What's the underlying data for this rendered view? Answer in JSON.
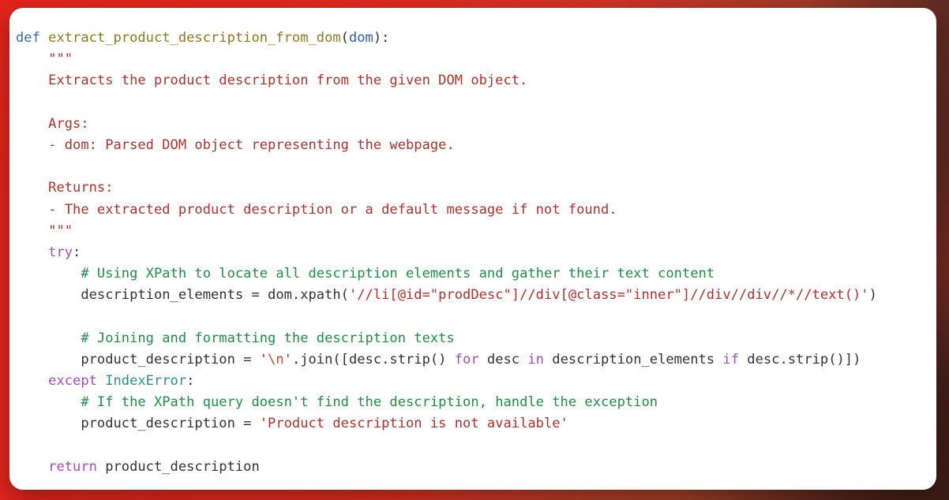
{
  "window": {
    "title": "Python code snippet",
    "background_colors": {
      "primary_red": "#e0241c",
      "dark_brown": "#3b211c",
      "card_background": "#ffffff"
    }
  },
  "editor": {
    "language": "python",
    "font": "monospace",
    "theme_colors": {
      "keyword": "#3a6ea5",
      "function_name": "#8f7a1e",
      "parameter": "#2b62bd",
      "string": "#b5312c",
      "escape": "#e8452d",
      "comment": "#1f9145",
      "control_keyword": "#a34cc4",
      "exception": "#2f8f8f",
      "plain_text": "#333333"
    },
    "lines": [
      {
        "n": 1,
        "text": "def extract_product_description_from_dom(dom):",
        "tokens": [
          {
            "t": "def",
            "c": "kw"
          },
          {
            "t": " ",
            "c": "plain"
          },
          {
            "t": "extract_product_description_from_dom",
            "c": "fname"
          },
          {
            "t": "(",
            "c": "punct"
          },
          {
            "t": "dom",
            "c": "param"
          },
          {
            "t": "):",
            "c": "punct"
          }
        ]
      },
      {
        "n": 2,
        "text": "    \"\"\"",
        "tokens": [
          {
            "t": "    \"\"\"",
            "c": "doc"
          }
        ]
      },
      {
        "n": 3,
        "text": "    Extracts the product description from the given DOM object.",
        "tokens": [
          {
            "t": "    Extracts the product description from the given DOM object.",
            "c": "doc"
          }
        ]
      },
      {
        "n": 4,
        "text": "",
        "tokens": []
      },
      {
        "n": 5,
        "text": "    Args:",
        "tokens": [
          {
            "t": "    Args:",
            "c": "doc"
          }
        ]
      },
      {
        "n": 6,
        "text": "    - dom: Parsed DOM object representing the webpage.",
        "tokens": [
          {
            "t": "    - dom: Parsed DOM object representing the webpage.",
            "c": "doc"
          }
        ]
      },
      {
        "n": 7,
        "text": "",
        "tokens": []
      },
      {
        "n": 8,
        "text": "    Returns:",
        "tokens": [
          {
            "t": "    Returns:",
            "c": "doc"
          }
        ]
      },
      {
        "n": 9,
        "text": "    - The extracted product description or a default message if not found.",
        "tokens": [
          {
            "t": "    - The extracted product description or a default message if not found.",
            "c": "doc"
          }
        ]
      },
      {
        "n": 10,
        "text": "    \"\"\"",
        "tokens": [
          {
            "t": "    \"\"\"",
            "c": "doc"
          }
        ]
      },
      {
        "n": 11,
        "text": "    try:",
        "tokens": [
          {
            "t": "    ",
            "c": "plain"
          },
          {
            "t": "try",
            "c": "ctl"
          },
          {
            "t": ":",
            "c": "punct"
          }
        ]
      },
      {
        "n": 12,
        "text": "        # Using XPath to locate all description elements and gather their text content",
        "tokens": [
          {
            "t": "        ",
            "c": "plain"
          },
          {
            "t": "# Using XPath to locate all description elements and gather their text content",
            "c": "com"
          }
        ]
      },
      {
        "n": 13,
        "text": "        description_elements = dom.xpath('//li[@id=\"prodDesc\"]//div[@class=\"inner\"]//div//div//*//text()')",
        "tokens": [
          {
            "t": "        description_elements = dom.xpath(",
            "c": "plain"
          },
          {
            "t": "'//li[@id=\"prodDesc\"]//div[@class=\"inner\"]//div//div//*//text()'",
            "c": "doc"
          },
          {
            "t": ")",
            "c": "punct"
          }
        ]
      },
      {
        "n": 14,
        "text": "",
        "tokens": []
      },
      {
        "n": 15,
        "text": "        # Joining and formatting the description texts",
        "tokens": [
          {
            "t": "        ",
            "c": "plain"
          },
          {
            "t": "# Joining and formatting the description texts",
            "c": "com"
          }
        ]
      },
      {
        "n": 16,
        "text": "        product_description = '\\n'.join([desc.strip() for desc in description_elements if desc.strip()])",
        "tokens": [
          {
            "t": "        product_description = ",
            "c": "plain"
          },
          {
            "t": "'",
            "c": "doc"
          },
          {
            "t": "\\n",
            "c": "esc"
          },
          {
            "t": "'",
            "c": "doc"
          },
          {
            "t": ".join([desc.strip() ",
            "c": "plain"
          },
          {
            "t": "for",
            "c": "ctl"
          },
          {
            "t": " desc ",
            "c": "plain"
          },
          {
            "t": "in",
            "c": "ctl"
          },
          {
            "t": " description_elements ",
            "c": "plain"
          },
          {
            "t": "if",
            "c": "ctl"
          },
          {
            "t": " desc.strip()])",
            "c": "plain"
          }
        ]
      },
      {
        "n": 17,
        "text": "    except IndexError:",
        "tokens": [
          {
            "t": "    ",
            "c": "plain"
          },
          {
            "t": "except",
            "c": "ctl"
          },
          {
            "t": " ",
            "c": "plain"
          },
          {
            "t": "IndexError",
            "c": "exc"
          },
          {
            "t": ":",
            "c": "punct"
          }
        ]
      },
      {
        "n": 18,
        "text": "        # If the XPath query doesn't find the description, handle the exception",
        "tokens": [
          {
            "t": "        ",
            "c": "plain"
          },
          {
            "t": "# If the XPath query doesn't find the description, handle the exception",
            "c": "com"
          }
        ]
      },
      {
        "n": 19,
        "text": "        product_description = 'Product description is not available'",
        "tokens": [
          {
            "t": "        product_description = ",
            "c": "plain"
          },
          {
            "t": "'Product description is not available'",
            "c": "doc"
          }
        ]
      },
      {
        "n": 20,
        "text": "",
        "tokens": []
      },
      {
        "n": 21,
        "text": "    return product_description",
        "tokens": [
          {
            "t": "    ",
            "c": "plain"
          },
          {
            "t": "return",
            "c": "ctl"
          },
          {
            "t": " product_description",
            "c": "plain"
          }
        ]
      }
    ]
  }
}
